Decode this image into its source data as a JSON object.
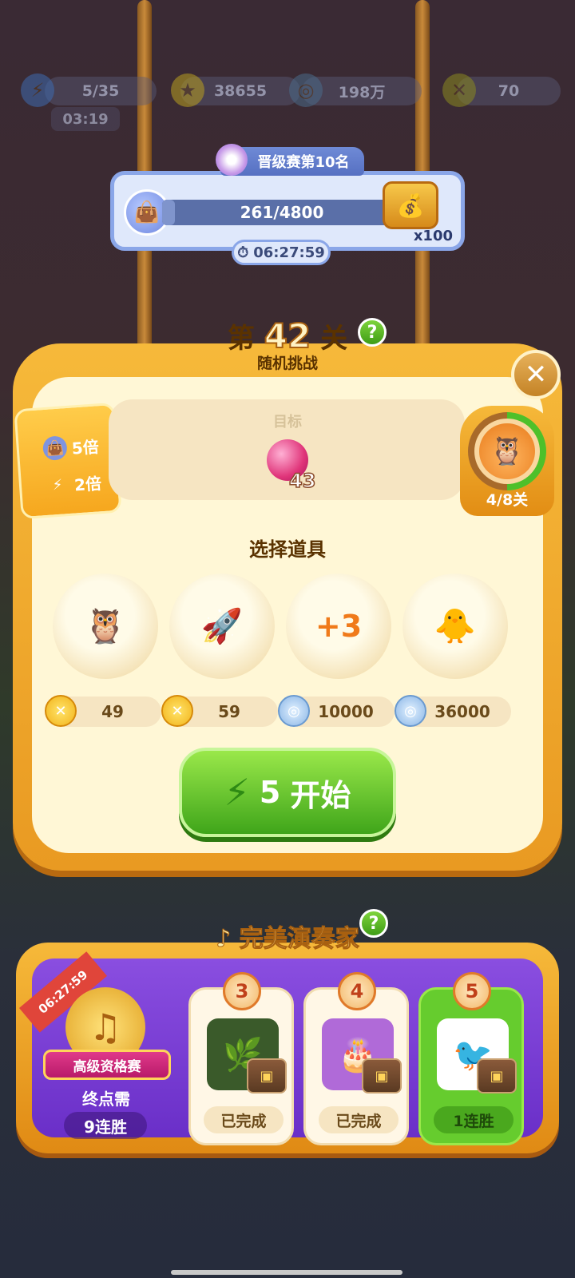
{
  "topbar": {
    "energy": "5/35",
    "energy_timer": "03:19",
    "stars": "38655",
    "coins": "198万",
    "tokens": "70"
  },
  "event": {
    "rank_title": "晋级赛第10名",
    "progress_text": "261/4800",
    "progress_fraction": 0.054,
    "reward_multiplier": "x100",
    "timer": "06:27:59"
  },
  "level": {
    "prefix": "第",
    "number": "42",
    "suffix": "关",
    "subtitle": "随机挑战",
    "help": "?",
    "close": "✕"
  },
  "bonus_tag": {
    "bag_multiplier": "5倍",
    "energy_multiplier": "2倍"
  },
  "goal": {
    "label": "目标",
    "gem_count": "43"
  },
  "stage_badge": {
    "text": "4/8关",
    "progress_fraction": 0.5
  },
  "boosters": {
    "title": "选择道具",
    "items": [
      {
        "icon": "rainbow-owl-icon",
        "glyph": "🦉",
        "price": "49",
        "currency": "gold"
      },
      {
        "icon": "rockets-icon",
        "glyph": "🚀",
        "price": "59",
        "currency": "gold"
      },
      {
        "icon": "plus-three-moves-icon",
        "glyph": "+3",
        "price": "10000",
        "currency": "silver"
      },
      {
        "icon": "pets-icon",
        "glyph": "🐥",
        "price": "36000",
        "currency": "silver"
      }
    ]
  },
  "start_button": {
    "cost": "5",
    "label": "开始"
  },
  "performer": {
    "title": "完美演奏家",
    "ribbon_timer": "06:27:59",
    "banner": "高级资格赛",
    "need_label": "终点需",
    "streak_need": "9连胜",
    "cards": [
      {
        "num": "3",
        "status": "已完成",
        "active": false,
        "glyph": "🌿"
      },
      {
        "num": "4",
        "status": "已完成",
        "active": false,
        "glyph": "🎂"
      },
      {
        "num": "5",
        "status": "1连胜",
        "active": true,
        "glyph": "🐦"
      }
    ]
  }
}
